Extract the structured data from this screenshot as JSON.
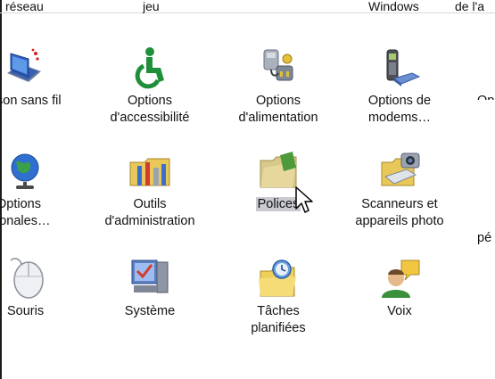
{
  "top_labels": [
    "réseau",
    "jeu",
    "Windows",
    "de l'a"
  ],
  "items": [
    {
      "label": "son sans fil",
      "icon": "wireless-laptop-icon"
    },
    {
      "label": "Options\nd'accessibilité",
      "icon": "accessibility-icon"
    },
    {
      "label": "Options\nd'alimentation",
      "icon": "power-plug-icon"
    },
    {
      "label": "Options de\nmodems…",
      "icon": "modem-phone-icon"
    },
    {
      "label": "Op",
      "icon": ""
    },
    {
      "label": "Options\nionales…",
      "icon": "globe-icon"
    },
    {
      "label": "Outils\nd'administration",
      "icon": "admin-tools-icon"
    },
    {
      "label": "Polices",
      "icon": "fonts-folder-icon"
    },
    {
      "label": "Scanneurs et\nappareils photo",
      "icon": "scanner-camera-icon"
    },
    {
      "label": "pé",
      "icon": ""
    },
    {
      "label": "Souris",
      "icon": "mouse-icon"
    },
    {
      "label": "Système",
      "icon": "system-monitor-icon"
    },
    {
      "label": "Tâches\nplanifiées",
      "icon": "scheduled-tasks-icon"
    },
    {
      "label": "Voix",
      "icon": "speech-icon"
    }
  ],
  "selection_color": "#c9cbd1"
}
